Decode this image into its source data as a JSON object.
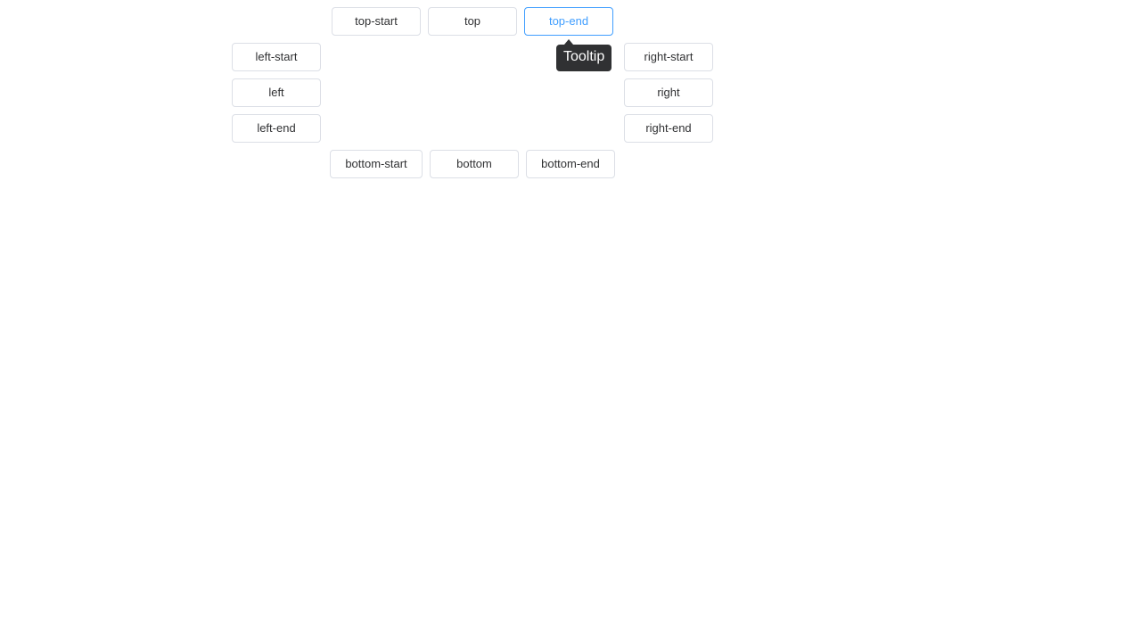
{
  "placement_buttons": {
    "top_start": "top-start",
    "top": "top",
    "top_end": "top-end",
    "left_start": "left-start",
    "left": "left",
    "left_end": "left-end",
    "right_start": "right-start",
    "right": "right",
    "right_end": "right-end",
    "bottom_start": "bottom-start",
    "bottom": "bottom",
    "bottom_end": "bottom-end"
  },
  "active_button": "top-end",
  "tooltip": {
    "text": "Tooltip"
  },
  "colors": {
    "accent": "#409eff",
    "tooltip_bg": "#303133",
    "button_border": "#dcdfe6"
  }
}
